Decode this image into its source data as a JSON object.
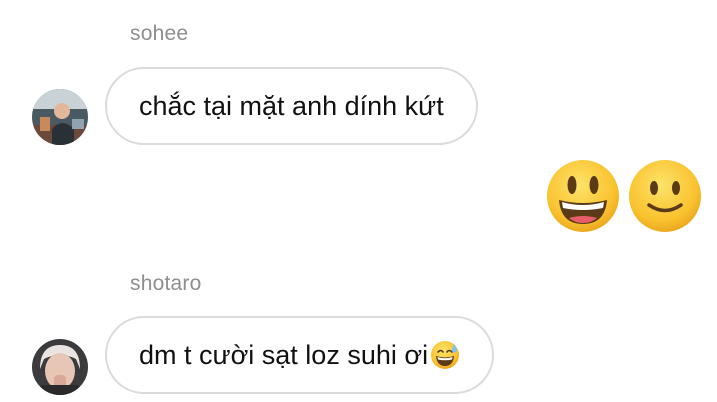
{
  "messages": [
    {
      "sender": "sohee",
      "text": "chắc tại mặt anh dính kứt",
      "avatar_icon": "user-photo-sohee"
    },
    {
      "sender": "me",
      "emojis": [
        "grinning-face-big-eyes",
        "slightly-smiling-face"
      ]
    },
    {
      "sender": "shotaro",
      "text": "dm t cười sạt loz suhi ơi",
      "trailing_emoji": "grinning-face-sweat",
      "avatar_icon": "user-photo-shotaro"
    }
  ],
  "colors": {
    "bubble_border": "#dbdbdb",
    "name_text": "#8e8e8e",
    "message_text": "#111111",
    "emoji_yellow": "#f9c22e"
  }
}
